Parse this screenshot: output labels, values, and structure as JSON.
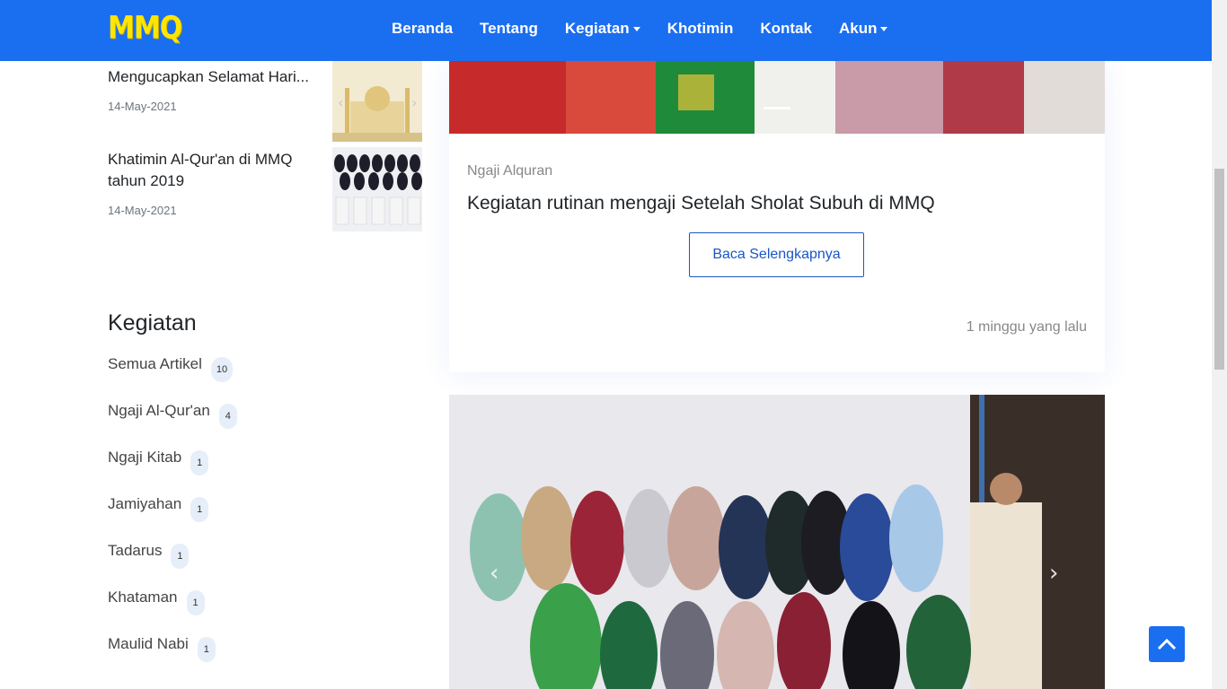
{
  "nav": {
    "logo": "MMQ",
    "items": [
      {
        "label": "Beranda",
        "dropdown": false
      },
      {
        "label": "Tentang",
        "dropdown": false
      },
      {
        "label": "Kegiatan",
        "dropdown": true
      },
      {
        "label": "Khotimin",
        "dropdown": false
      },
      {
        "label": "Kontak",
        "dropdown": false
      },
      {
        "label": "Akun",
        "dropdown": true
      }
    ]
  },
  "recent_posts": [
    {
      "title": "Mengucapkan Selamat Hari...",
      "date": "14-May-2021"
    },
    {
      "title": "Khatimin Al-Qur'an di MMQ tahun 2019",
      "date": "14-May-2021"
    }
  ],
  "sidebar": {
    "heading": "Kegiatan",
    "categories": [
      {
        "label": "Semua Artikel",
        "count": "10"
      },
      {
        "label": "Ngaji Al-Qur'an",
        "count": "4"
      },
      {
        "label": "Ngaji Kitab",
        "count": "1"
      },
      {
        "label": "Jamiyahan",
        "count": "1"
      },
      {
        "label": "Tadarus",
        "count": "1"
      },
      {
        "label": "Khataman",
        "count": "1"
      },
      {
        "label": "Maulid Nabi",
        "count": "1"
      }
    ]
  },
  "main_card": {
    "category": "Ngaji Alquran",
    "title": "Kegiatan rutinan mengaji Setelah Sholat Subuh di MMQ",
    "button": "Baca Selengkapnya",
    "time": "1 minggu yang lalu"
  },
  "colors": {
    "brand": "#1a6ef0",
    "logo": "#ffe500",
    "button_border": "#1a56c4"
  }
}
